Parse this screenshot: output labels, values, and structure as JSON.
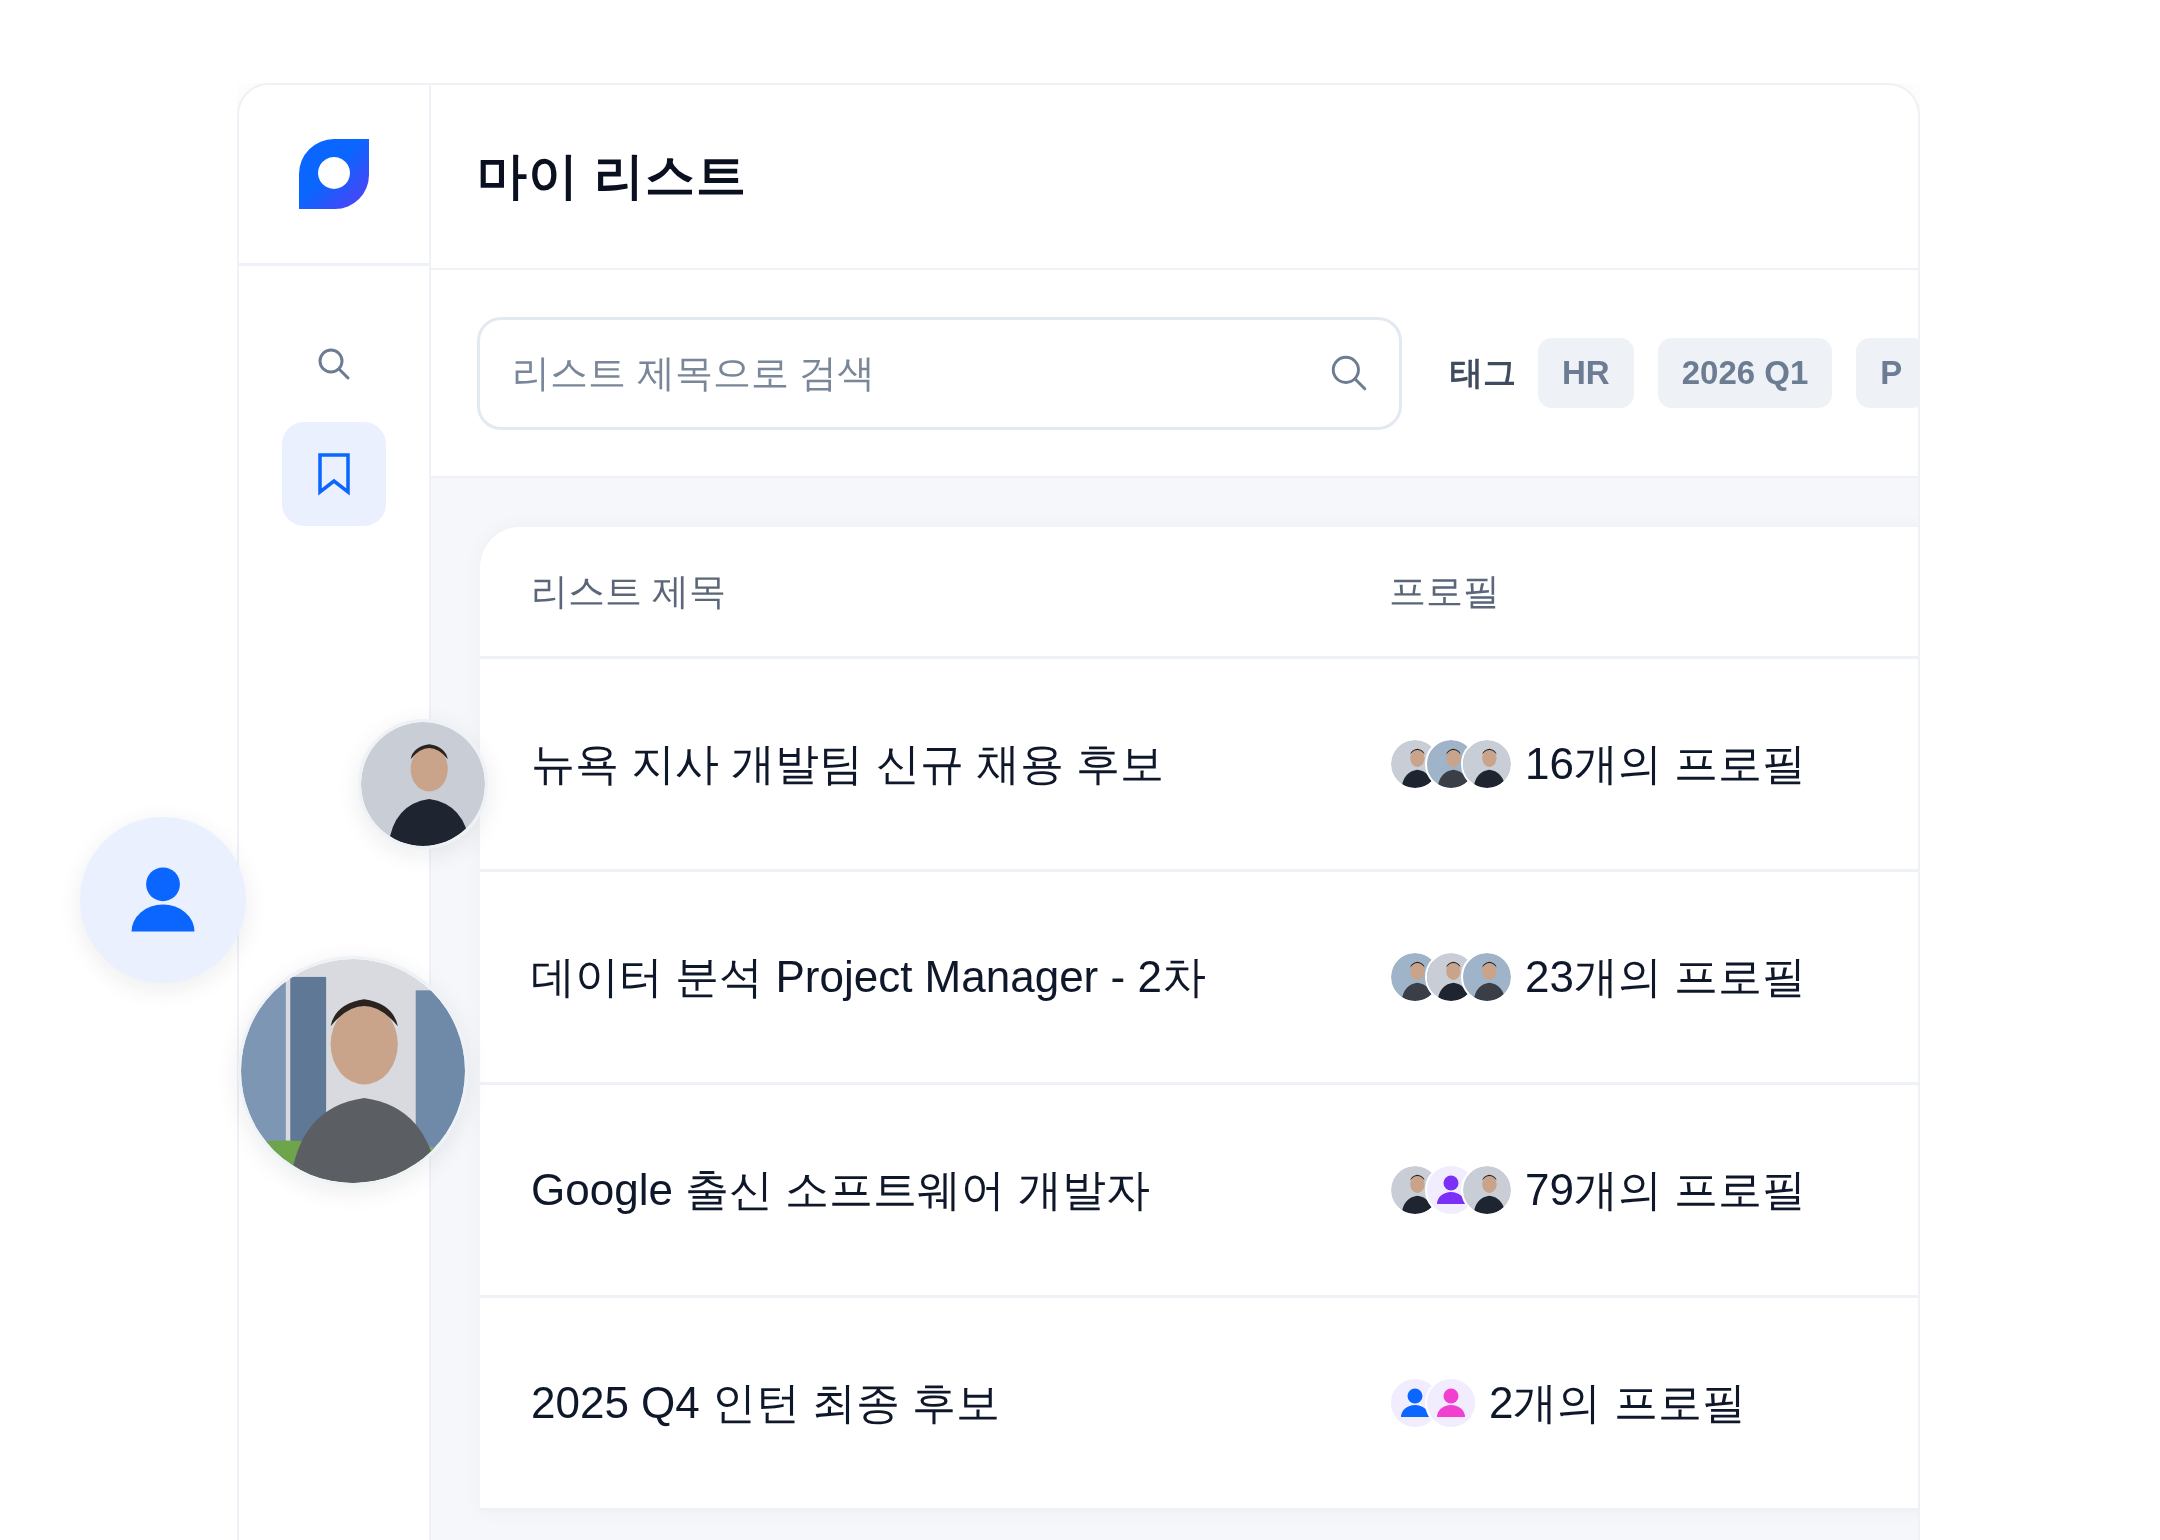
{
  "page": {
    "title": "마이 리스트"
  },
  "sidebar": {
    "items": [
      {
        "kind": "search",
        "selected": false
      },
      {
        "kind": "bookmark",
        "selected": true
      }
    ]
  },
  "search": {
    "placeholder": "리스트 제목으로 검색"
  },
  "tags": {
    "label": "태그",
    "items": [
      "HR",
      "2026 Q1",
      "P"
    ]
  },
  "table": {
    "columns": [
      "리스트 제목",
      "프로필"
    ],
    "rows": [
      {
        "title": "뉴욕 지사 개발팀 신규 채용 후보",
        "profiles": "16개의 프로필",
        "avatars": [
          {
            "kind": "picture"
          },
          {
            "kind": "picture"
          },
          {
            "kind": "picture"
          }
        ]
      },
      {
        "title": "데이터 분석 Project Manager - 2차",
        "profiles": "23개의 프로필",
        "avatars": [
          {
            "kind": "picture"
          },
          {
            "kind": "picture"
          },
          {
            "kind": "picture"
          }
        ]
      },
      {
        "title": "Google 출신 소프트웨어 개발자",
        "profiles": "79개의 프로필",
        "avatars": [
          {
            "kind": "picture"
          },
          {
            "kind": "placeholder",
            "color": "#7b2ff7"
          },
          {
            "kind": "picture"
          }
        ]
      },
      {
        "title": "2025 Q4 인턴 최종 후보",
        "profiles": "2개의 프로필",
        "avatars": [
          {
            "kind": "placeholder",
            "color": "#0a66ff"
          },
          {
            "kind": "placeholder",
            "color": "#f23fd0"
          }
        ]
      }
    ]
  },
  "floating_profiles": [
    {
      "kind": "picture"
    },
    {
      "kind": "placeholder",
      "color": "#0a66ff"
    },
    {
      "kind": "picture"
    }
  ]
}
